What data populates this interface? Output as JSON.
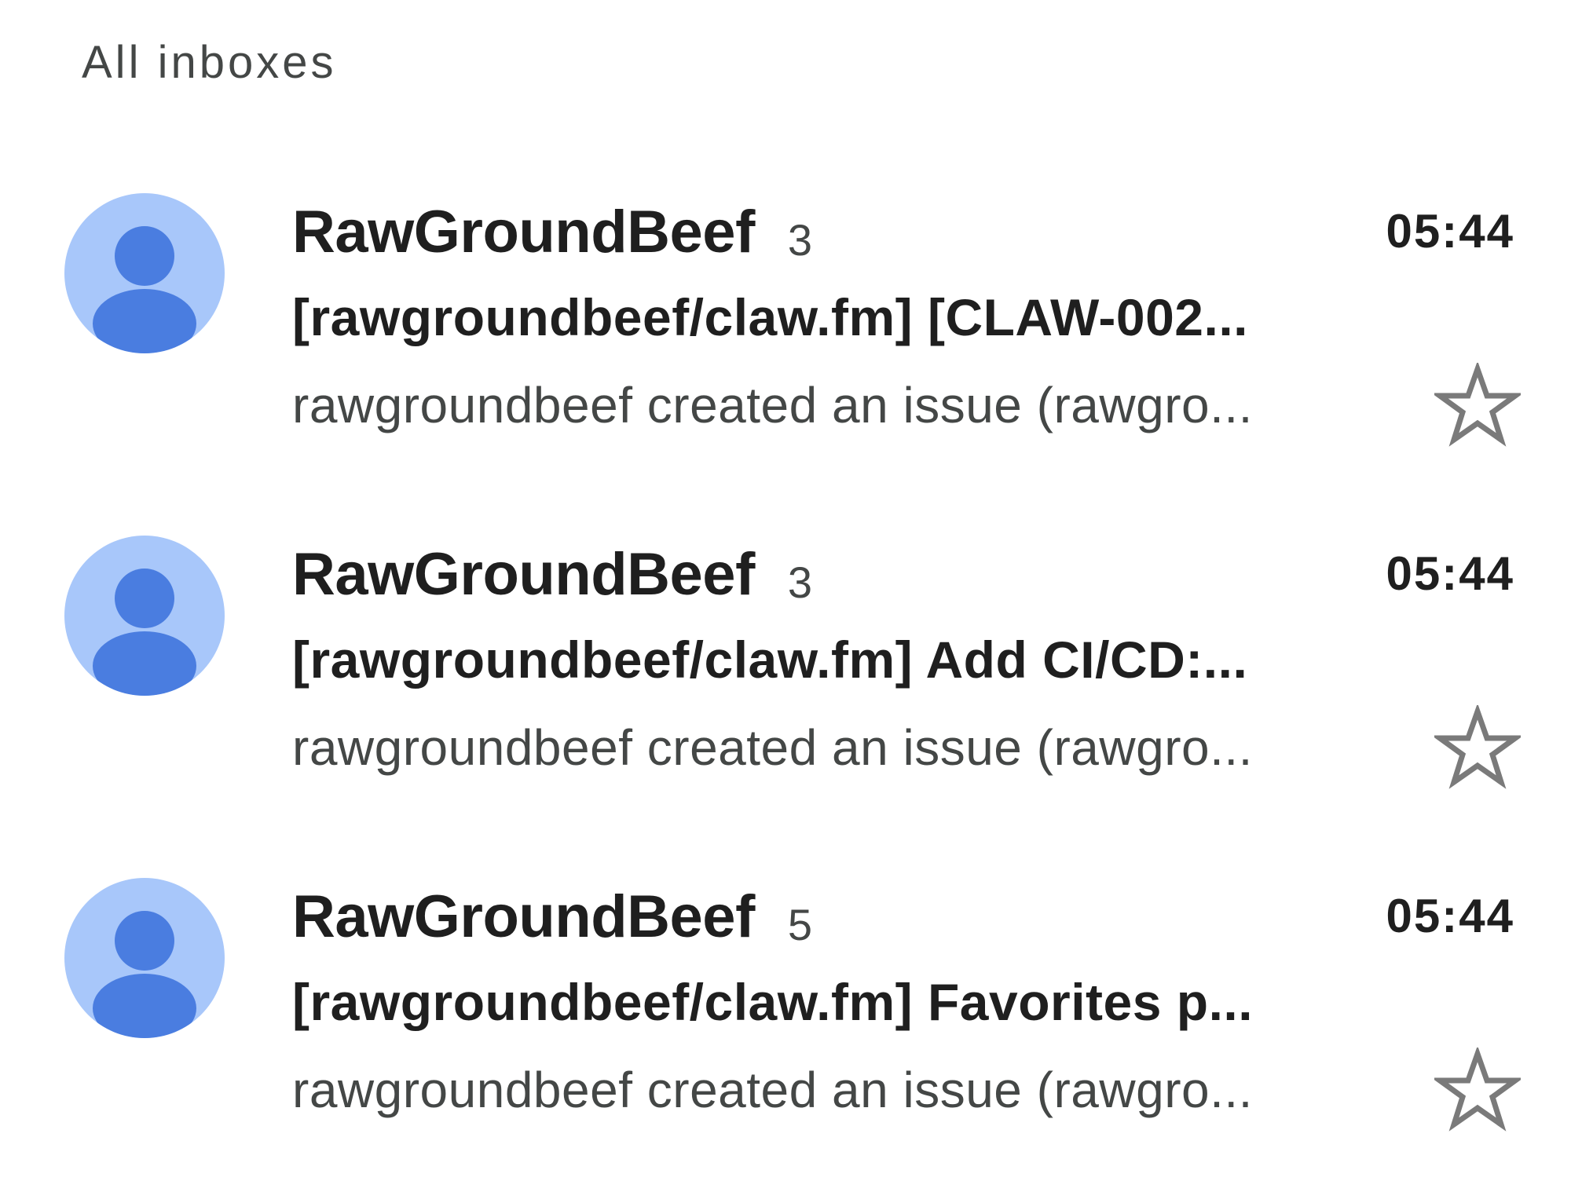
{
  "header": {
    "title": "All inboxes"
  },
  "emails": [
    {
      "sender": "RawGroundBeef",
      "count": "3",
      "time": "05:44",
      "subject": "[rawgroundbeef/claw.fm] [CLAW-002...",
      "snippet": "rawgroundbeef created an issue (rawgro...",
      "starred": false,
      "avatar_icon": "person-icon"
    },
    {
      "sender": "RawGroundBeef",
      "count": "3",
      "time": "05:44",
      "subject": "[rawgroundbeef/claw.fm] Add CI/CD:...",
      "snippet": "rawgroundbeef created an issue (rawgro...",
      "starred": false,
      "avatar_icon": "person-icon"
    },
    {
      "sender": "RawGroundBeef",
      "count": "5",
      "time": "05:44",
      "subject": "[rawgroundbeef/claw.fm] Favorites p...",
      "snippet": "rawgroundbeef created an issue (rawgro...",
      "starred": false,
      "avatar_icon": "person-icon"
    }
  ],
  "colors": {
    "avatar_background": "#a8c7fa",
    "avatar_figure": "#4a7de0",
    "star_outline": "#7a7a7a",
    "primary_text": "#1f1f1f",
    "secondary_text": "#444746"
  }
}
